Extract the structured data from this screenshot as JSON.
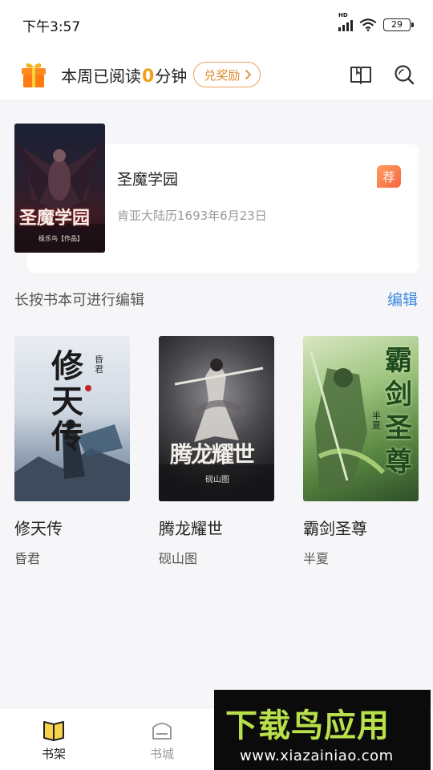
{
  "status_bar": {
    "time": "下午3:57",
    "network": "HD",
    "battery": "29"
  },
  "header": {
    "reading_prefix": "本周已阅读",
    "reading_minutes": "0",
    "reading_suffix": "分钟",
    "reward_label": "兑奖励",
    "icons": [
      "gift-icon",
      "book-icon",
      "search-icon"
    ]
  },
  "recommended": {
    "title": "圣魔学园",
    "subtitle": "肯亚大陆历1693年6月23日",
    "badge": "荐",
    "cover_title": "圣魔学园",
    "cover_caption": "极乐鸟【作品】"
  },
  "shelf": {
    "hint": "长按书本可进行编辑",
    "edit_label": "编辑",
    "books": [
      {
        "title": "修天传",
        "author": "昏君",
        "cover_title": "修天传",
        "cover_author": "昏君"
      },
      {
        "title": "腾龙耀世",
        "author": "砚山图",
        "cover_title": "腾龙耀世",
        "cover_author": "砚山图"
      },
      {
        "title": "霸剑圣尊",
        "author": "半夏",
        "cover_title": "霸剑圣尊",
        "cover_author": "半夏"
      }
    ]
  },
  "bottom_nav": {
    "items": [
      {
        "label": "书架",
        "icon": "bookshelf-icon",
        "active": true
      },
      {
        "label": "书城",
        "icon": "bookstore-icon",
        "active": false
      }
    ]
  },
  "watermark": {
    "logo": "下载鸟应用",
    "url": "www.xiazainiao.com"
  },
  "colors": {
    "accent_orange": "#f0a21d",
    "reward_border": "#e9a25a",
    "edit_blue": "#3d8ae0",
    "badge": "#f4673f",
    "background": "#f6f6f8"
  }
}
